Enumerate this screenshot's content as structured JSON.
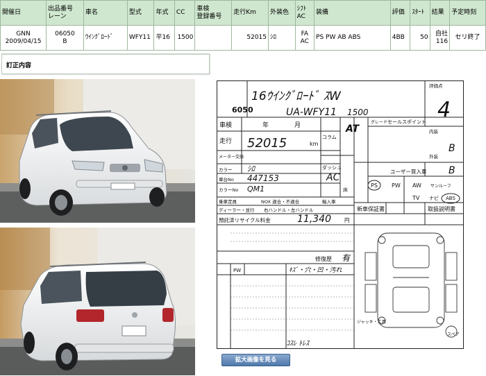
{
  "table": {
    "headers": {
      "date": "開催日",
      "lot_line1": "出品番号",
      "lot_line2": "レーン",
      "model": "車名",
      "chassis": "型式",
      "year": "年式",
      "cc": "CC",
      "inspection_line1": "車検",
      "inspection_line2": "登録番号",
      "mileage": "走行Km",
      "color": "外装色",
      "shift_line1": "ｼﾌﾄ",
      "shift_line2": "AC",
      "equipment": "装備",
      "grade": "評価",
      "start": "ｽﾀｰﾄ",
      "result": "結果",
      "schedule": "予定時刻"
    },
    "row": {
      "auction_house": "GNN",
      "date": "2009/04/15",
      "lot_number": "06050",
      "lane": "B",
      "model": "ｳｲﾝｸﾞﾛｰﾄﾞ",
      "chassis": "WFY11",
      "year": "平16",
      "cc": "1500",
      "inspection": "",
      "mileage": "52015",
      "color": "ｼﾛ",
      "shift": "FA",
      "ac": "AC",
      "equipment": "PS PW AB ABS",
      "grade": "4BB",
      "start": "50",
      "result_line1": "自社",
      "result_line2": "116",
      "schedule": "セリ終了"
    }
  },
  "correction": {
    "title": "訂正内容"
  },
  "sheet": {
    "lot_number": "6050",
    "hw_model": "16ｳｲﾝｸﾞﾛｰﾄﾞ ｽW",
    "hw_chassis": "UA-WFY11",
    "hw_cc": "1500",
    "hw_mileage": "52015",
    "hw_grade": "4",
    "hw_interior_top": "B",
    "hw_interior_bottom": "B",
    "hw_color": "ｼﾛ",
    "hw_color_no": "QM1",
    "hw_frame_no": "447153",
    "hw_shift": "AT",
    "hw_ac": "AC",
    "hw_recycle": "11,340",
    "hw_history": "有",
    "hw_notes": "ｷｽﾞ・穴・凹・汚れ",
    "hw_bottom": "ｺｽﾚ ﾄﾚｽ",
    "label_inspection": "車検",
    "label_year": "年",
    "label_month": "月",
    "label_mileage": "走行",
    "label_km": "km",
    "label_meter": "メーター交換",
    "label_color": "カラー",
    "label_color_no": "カラーNo",
    "label_frame": "車台No",
    "label_capacity": "乗車定員",
    "label_nox": "NOX 適合・不適合",
    "label_import": "輸入車",
    "label_dealer": "ディーラー・並行",
    "label_handle": "右ハンドル・左ハンドル",
    "label_recycle_fee": "預託済リサイクル料金",
    "label_recycle_unit": "円",
    "label_repair": "修復歴",
    "label_pw": "PW",
    "label_ps": "PS",
    "label_aw": "AW",
    "label_sunroof": "サンルーフ",
    "label_tv": "TV",
    "label_navi": "ナビ",
    "label_abs": "ABS",
    "label_new_warranty": "新車保証書",
    "label_manual": "取扱説明書",
    "label_column": "コラム",
    "label_dash": "ダッシュ",
    "label_floor": "床",
    "label_grade_box": "評価点",
    "label_interior": "内装",
    "label_exterior": "外装",
    "label_sales_point": "セールスポイント",
    "label_user_car": "ユーザー買入車",
    "label_spare": "スペア",
    "label_key": "キー",
    "label_nav_small": "ジャッキ・工具",
    "label_sheet_grade": "グレード",
    "label_shift_label": "シフト"
  },
  "enlarge_button": {
    "label": "拡大画像を見る"
  }
}
